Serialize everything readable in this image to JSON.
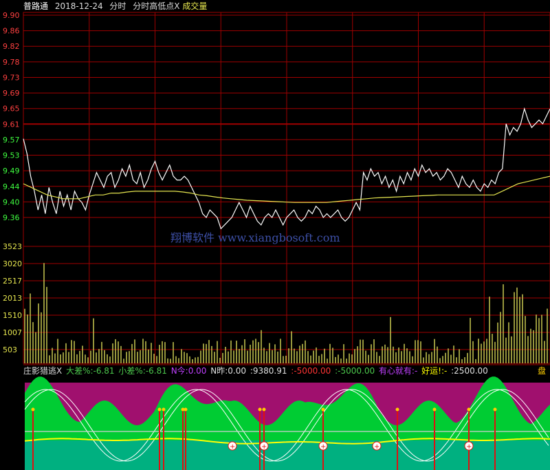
{
  "header": {
    "app": "普路通",
    "date": "2018-12-24",
    "mode": "分时",
    "indicator": "分时高低点X",
    "volume_label": "成交量"
  },
  "indicator_panel": {
    "name": "庄影猎逃X",
    "items": [
      {
        "label": "大差%:",
        "value": "-6.81",
        "color": "#4cc84c"
      },
      {
        "label": "小差%:",
        "value": "-6.81",
        "color": "#4cc84c"
      },
      {
        "label": "N今:",
        "value": "0.00",
        "color": "#c040ff"
      },
      {
        "label": "N昨:",
        "value": "0.00",
        "color": "#e0e0e0"
      },
      {
        "label": ":",
        "value": "9380.91",
        "color": "#e0e0e0"
      },
      {
        "label": ":",
        "value": "-5000.00",
        "color": "#ff3333"
      },
      {
        "label": ":",
        "value": "-5000.00",
        "color": "#4cc84c"
      },
      {
        "label": "有心就有:",
        "value": "-",
        "color": "#c040ff"
      },
      {
        "label": "好运!",
        "value": ":-",
        "color": "#ffff00"
      },
      {
        "label": ":",
        "value": "2500.00",
        "color": "#e0e0e0"
      }
    ],
    "right_label": "盘"
  },
  "watermark": "翔博软件 www.xiangbosoft.com",
  "colors": {
    "grid": "#a00000",
    "price_line": "#ffffff",
    "avg_line": "#e8e850",
    "volume_bar": "#c8c850",
    "price_axis_up": "#ff4040",
    "price_axis_down": "#40ff40",
    "magenta_bg": "#a0106e",
    "green_fill": "#00cc33",
    "teal_fill": "#00b080",
    "yellow_line": "#ffff00"
  },
  "chart_data": {
    "type": "line",
    "price_axis": {
      "ticks": [
        "9.90",
        "9.86",
        "9.82",
        "9.78",
        "9.73",
        "9.69",
        "9.65",
        "9.61",
        "9.57",
        "9.53",
        "9.49",
        "9.44",
        "9.40",
        "9.36"
      ],
      "ylim": [
        9.36,
        9.9
      ]
    },
    "volume_axis": {
      "ticks": [
        "3523",
        "3020",
        "2517",
        "2013",
        "1510",
        "1007",
        "503"
      ]
    },
    "series": [
      {
        "values": [
          9.57,
          9.53,
          9.47,
          9.43,
          9.38,
          9.42,
          9.37,
          9.44,
          9.4,
          9.37,
          9.43,
          9.39,
          9.42,
          9.38,
          9.43,
          9.41,
          9.4,
          9.38,
          9.42,
          9.45,
          9.48,
          9.46,
          9.44,
          9.47,
          9.48,
          9.44,
          9.46,
          9.49,
          9.47,
          9.5,
          9.46,
          9.45,
          9.48,
          9.44,
          9.46,
          9.49,
          9.51,
          9.48,
          9.46,
          9.48,
          9.5,
          9.47,
          9.46,
          9.46,
          9.47,
          9.46,
          9.44,
          9.42,
          9.4,
          9.37,
          9.36,
          9.38,
          9.37,
          9.36,
          9.33,
          9.34,
          9.35,
          9.36,
          9.38,
          9.4,
          9.38,
          9.36,
          9.39,
          9.37,
          9.35,
          9.34,
          9.36,
          9.37,
          9.36,
          9.38,
          9.36,
          9.34,
          9.36,
          9.37,
          9.38,
          9.36,
          9.35,
          9.36,
          9.38,
          9.37,
          9.39,
          9.38,
          9.36,
          9.37,
          9.36,
          9.37,
          9.38,
          9.36,
          9.35,
          9.36,
          9.38,
          9.4,
          9.38,
          9.48,
          9.46,
          9.49,
          9.47,
          9.48,
          9.45,
          9.47,
          9.44,
          9.46,
          9.43,
          9.47,
          9.45,
          9.48,
          9.46,
          9.49,
          9.47,
          9.5,
          9.48,
          9.49,
          9.47,
          9.48,
          9.46,
          9.47,
          9.49,
          9.48,
          9.46,
          9.44,
          9.47,
          9.45,
          9.44,
          9.46,
          9.44,
          9.43,
          9.45,
          9.44,
          9.46,
          9.45,
          9.48,
          9.49,
          9.61,
          9.58,
          9.6,
          9.59,
          9.61,
          9.65,
          9.62,
          9.6,
          9.61,
          9.62,
          9.61,
          9.63,
          9.65
        ]
      },
      {
        "values": [
          9.45,
          9.44,
          9.43,
          9.42,
          9.415,
          9.41,
          9.41,
          9.41,
          9.415,
          9.42,
          9.42,
          9.425,
          9.425,
          9.428,
          9.43,
          9.43,
          9.43,
          9.43,
          9.43,
          9.43,
          9.428,
          9.425,
          9.42,
          9.418,
          9.415,
          9.412,
          9.41,
          9.408,
          9.406,
          9.405,
          9.404,
          9.403,
          9.402,
          9.401,
          9.4,
          9.4,
          9.4,
          9.4,
          9.4,
          9.402,
          9.404,
          9.406,
          9.408,
          9.41,
          9.412,
          9.413,
          9.414,
          9.415,
          9.416,
          9.417,
          9.418,
          9.419,
          9.42,
          9.42,
          9.42,
          9.42,
          9.42,
          9.42,
          9.42,
          9.42,
          9.43,
          9.44,
          9.45,
          9.455,
          9.46,
          9.465,
          9.47
        ]
      }
    ]
  }
}
